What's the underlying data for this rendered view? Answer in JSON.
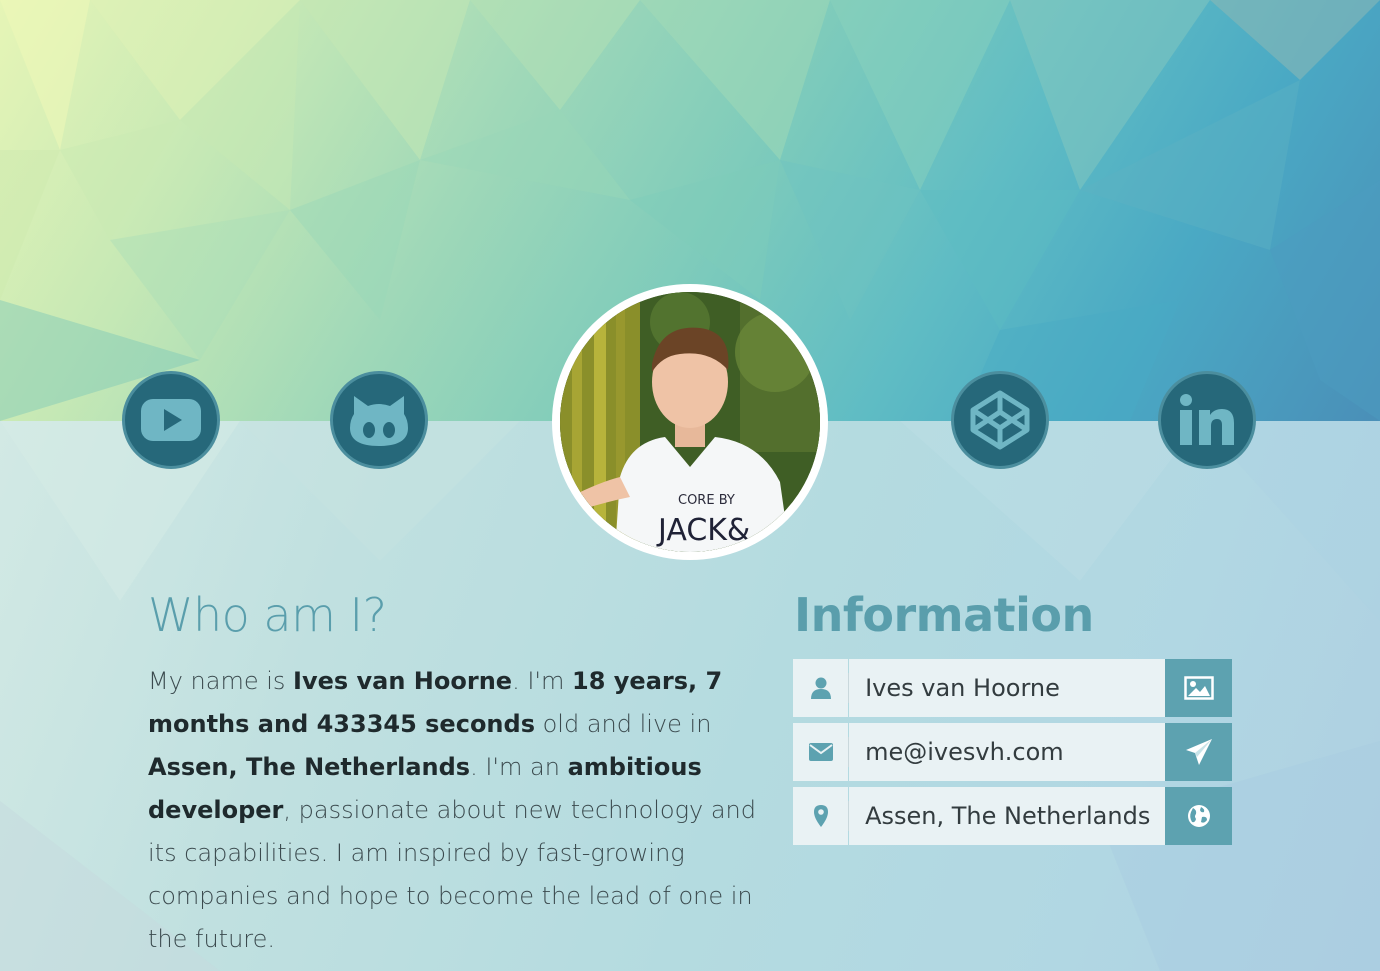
{
  "social": {
    "left": [
      {
        "name": "youtube",
        "icon": "youtube-icon"
      },
      {
        "name": "github",
        "icon": "github-icon"
      }
    ],
    "right": [
      {
        "name": "codepen",
        "icon": "codepen-icon"
      },
      {
        "name": "linkedin",
        "icon": "linkedin-icon"
      }
    ]
  },
  "profile": {
    "avatar_alt": "Ives van Hoorne",
    "shirt_line1": "CORE BY",
    "shirt_line2": "JACK&"
  },
  "about": {
    "title": "Who am I?",
    "t1": "My name is ",
    "name": "Ives van Hoorne",
    "t2": ". I'm ",
    "age": "18 years, 7 months and 433345 seconds",
    "t3": " old and live in ",
    "location": "Assen, The Netherlands",
    "t4": ". I'm an ",
    "role": "ambitious developer",
    "t5": ", passionate about new technology and its capabilities. I am inspired by fast-growing companies and hope to become the lead of one in the future."
  },
  "info": {
    "title": "Information",
    "rows": [
      {
        "icon": "user-icon",
        "value": "Ives van Hoorne",
        "action_icon": "image-icon"
      },
      {
        "icon": "envelope-icon",
        "value": "me@ivesvh.com",
        "action_icon": "send-icon"
      },
      {
        "icon": "map-marker-icon",
        "value": "Assen, The Netherlands",
        "action_icon": "globe-icon"
      }
    ]
  },
  "colors": {
    "accent": "#5da2b0",
    "social_bg": "#26687a",
    "title": "#5a9eac"
  }
}
